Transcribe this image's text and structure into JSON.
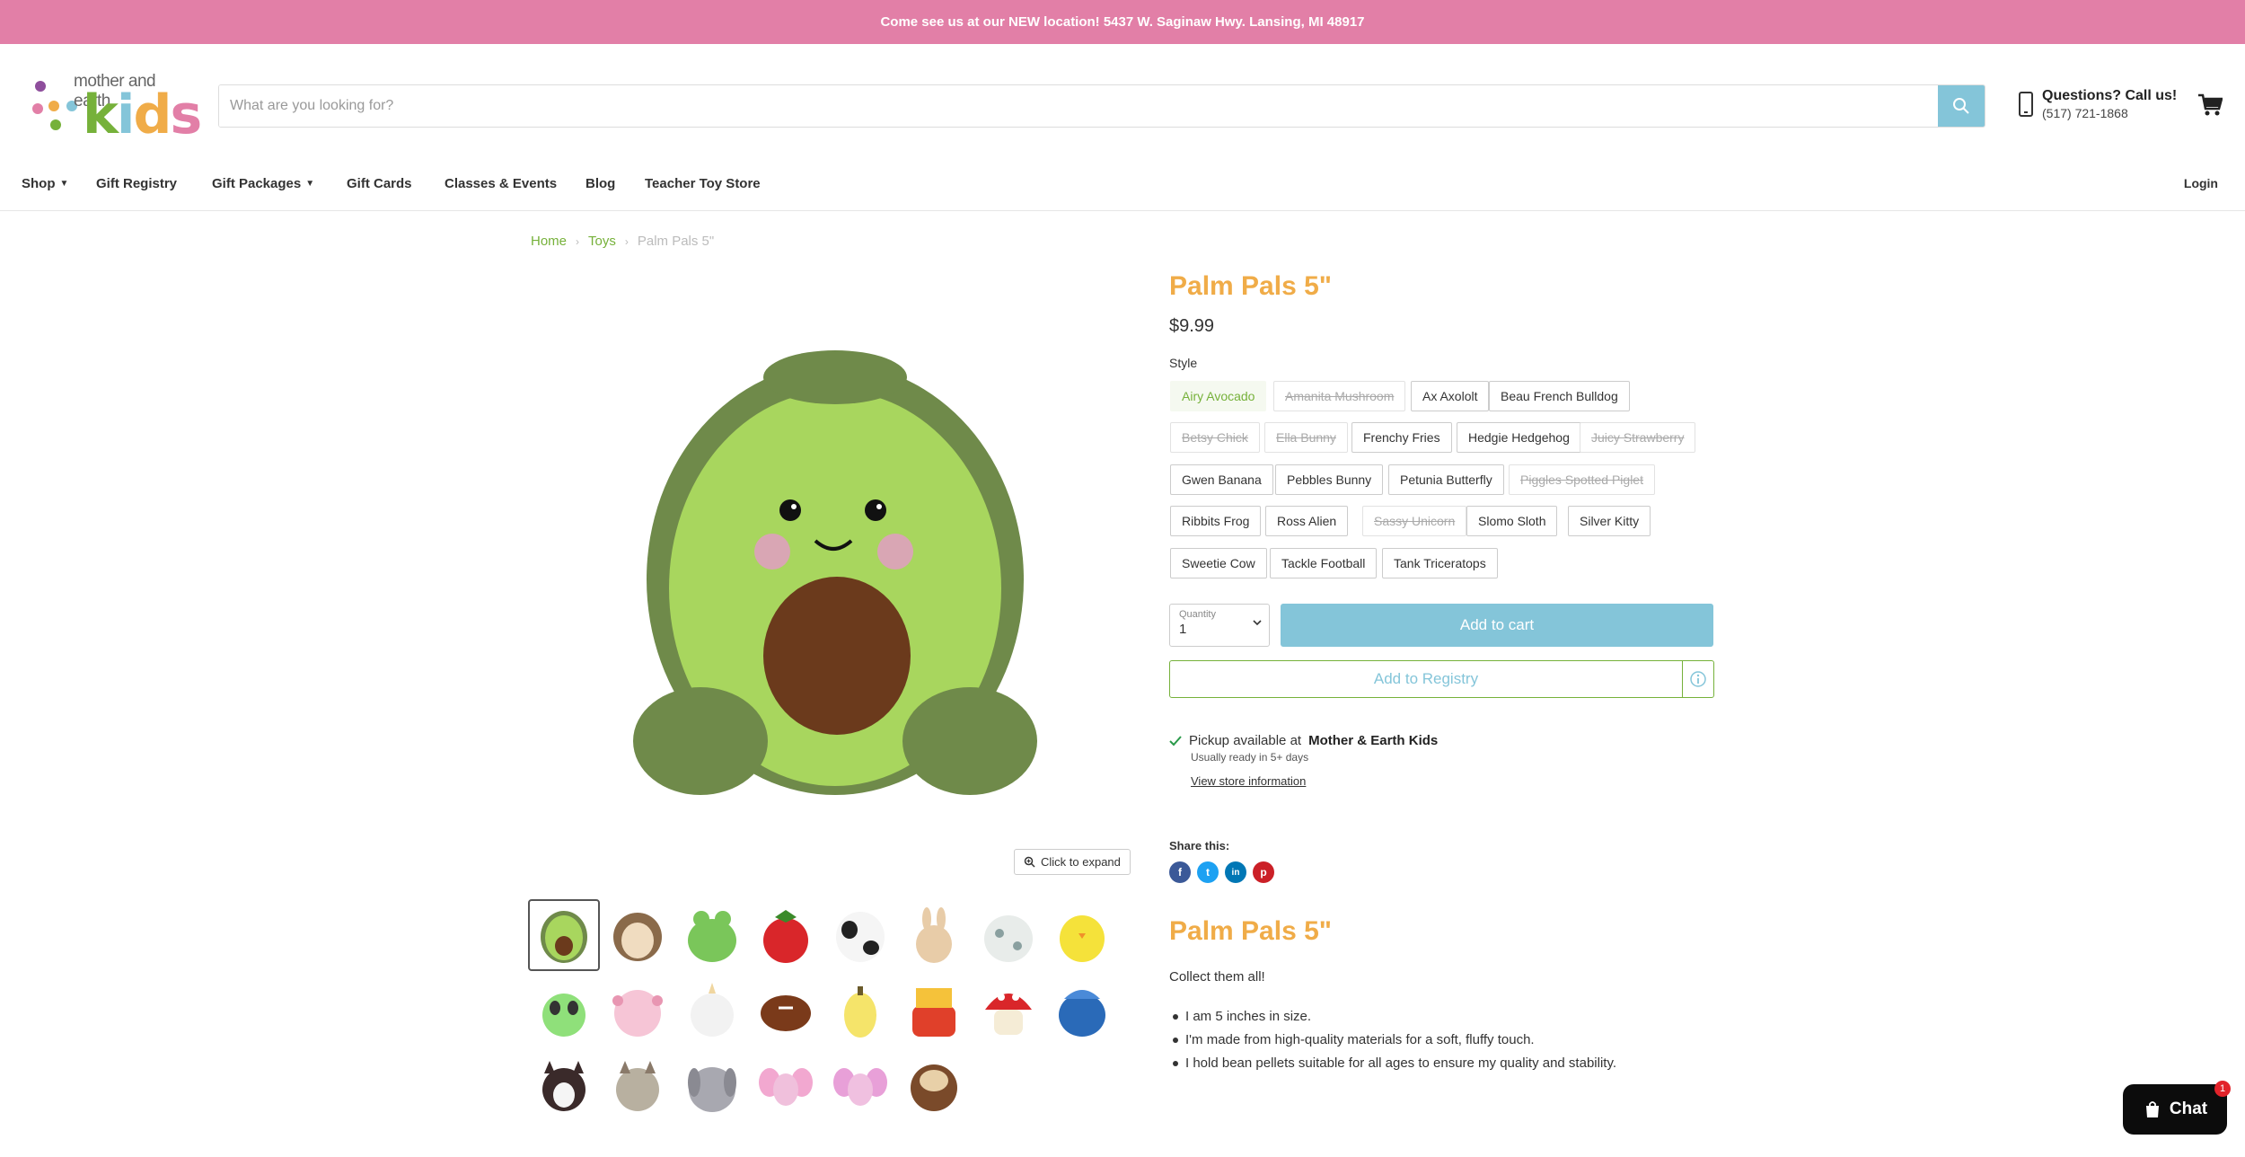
{
  "announcement": "Come see us at our NEW location! 5437 W. Saginaw Hwy. Lansing, MI 48917",
  "logo": {
    "line1": "mother and earth",
    "line2": "kids"
  },
  "search": {
    "placeholder": "What are you looking for?",
    "icon": "search-icon"
  },
  "contact": {
    "title": "Questions? Call us!",
    "phone": "(517) 721-1868"
  },
  "nav": {
    "items": [
      {
        "label": "Shop",
        "dropdown": true
      },
      {
        "label": "Gift Registry",
        "dropdown": false
      },
      {
        "label": "Gift Packages",
        "dropdown": true
      },
      {
        "label": "Gift Cards",
        "dropdown": false
      },
      {
        "label": "Classes & Events",
        "dropdown": false
      },
      {
        "label": "Blog",
        "dropdown": false
      },
      {
        "label": "Teacher Toy Store",
        "dropdown": false
      }
    ],
    "login": "Login"
  },
  "breadcrumb": {
    "home": "Home",
    "category": "Toys",
    "current": "Palm Pals 5\""
  },
  "gallery": {
    "expand_label": "Click to expand"
  },
  "product": {
    "title": "Palm Pals 5\"",
    "price": "$9.99",
    "style_label": "Style",
    "styles": [
      {
        "label": "Airy Avocado",
        "state": "active"
      },
      {
        "label": "Amanita Mushroom",
        "state": "unavailable"
      },
      {
        "label": "Ax Axololt",
        "state": "available"
      },
      {
        "label": "Beau French Bulldog",
        "state": "available"
      },
      {
        "label": "Betsy Chick",
        "state": "unavailable"
      },
      {
        "label": "Ella Bunny",
        "state": "unavailable"
      },
      {
        "label": "Frenchy Fries",
        "state": "available"
      },
      {
        "label": "Hedgie Hedgehog",
        "state": "available"
      },
      {
        "label": "Juicy Strawberry",
        "state": "unavailable"
      },
      {
        "label": "Gwen Banana",
        "state": "available"
      },
      {
        "label": "Pebbles Bunny",
        "state": "available"
      },
      {
        "label": "Petunia Butterfly",
        "state": "available"
      },
      {
        "label": "Piggles Spotted Piglet",
        "state": "unavailable"
      },
      {
        "label": "Ribbits Frog",
        "state": "available"
      },
      {
        "label": "Ross Alien",
        "state": "available"
      },
      {
        "label": "Sassy Unicorn",
        "state": "unavailable"
      },
      {
        "label": "Slomo Sloth",
        "state": "available"
      },
      {
        "label": "Silver Kitty",
        "state": "available"
      },
      {
        "label": "Sweetie Cow",
        "state": "available"
      },
      {
        "label": "Tackle Football",
        "state": "available"
      },
      {
        "label": "Tank Triceratops",
        "state": "available"
      }
    ],
    "quantity_label": "Quantity",
    "quantity_value": "1",
    "add_to_cart": "Add to cart",
    "add_to_registry": "Add to Registry"
  },
  "pickup": {
    "prefix": "Pickup available at",
    "store": "Mother & Earth Kids",
    "ready": "Usually ready in 5+ days",
    "store_link": "View store information"
  },
  "share": {
    "label": "Share this:",
    "networks": [
      "f",
      "t",
      "in",
      "p"
    ]
  },
  "description": {
    "title": "Palm Pals 5\"",
    "intro": "Collect them all!",
    "bullets": [
      "I am 5 inches in size.",
      "I'm made from high-quality materials for a soft, fluffy touch.",
      "I hold bean pellets suitable for all ages to ensure my quality and stability."
    ]
  },
  "chat": {
    "label": "Chat",
    "badge": "1"
  },
  "colors": {
    "announcement_bg": "#e27fa7",
    "accent_blue": "#84c5d9",
    "accent_orange": "#f0ac48",
    "accent_green": "#76b13a"
  }
}
